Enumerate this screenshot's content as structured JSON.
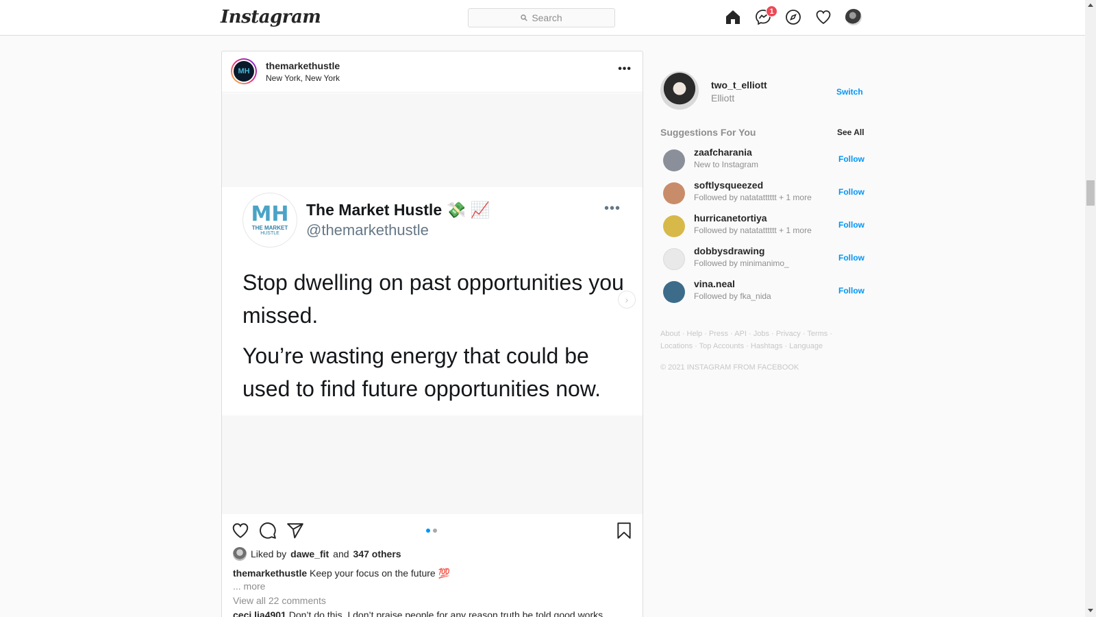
{
  "nav": {
    "logo": "Instagram",
    "search_placeholder": "Search",
    "messages_badge": "1",
    "icons": [
      "home-icon",
      "messenger-icon",
      "explore-icon",
      "activity-heart-icon",
      "profile-avatar"
    ]
  },
  "post": {
    "username": "themarkethustle",
    "location": "New York, New York",
    "more": "•••",
    "tweet": {
      "name": "The Market Hustle 💸 📈",
      "handle": "@themarkethustle",
      "logo_text": "MH",
      "logo_sub": "THE MARKET",
      "logo_sub2": "HUSTLE",
      "more": "•••",
      "text1": "Stop dwelling on past opportunities you missed.",
      "text2": "You’re wasting energy that could be used to find future opportunities now."
    },
    "next_arrow": "›",
    "carousel": {
      "count": 2,
      "active_index": 0
    },
    "likes": {
      "prefix": "Liked by",
      "user": "dawe_fit",
      "middle": "and",
      "others": "347 others"
    },
    "caption": {
      "username": "themarkethustle",
      "text": "Keep your focus on the future 💯"
    },
    "more_label": "... more",
    "view_comments": "View all 22 comments",
    "comment": {
      "username": "ceci.lia4901",
      "text": "Don’t do this. I don’t praise people for any reason truth be told good works"
    }
  },
  "sidebar": {
    "username": "two_t_elliott",
    "name": "Elliott",
    "switch": "Switch",
    "suggestions_title": "Suggestions For You",
    "see_all": "See All",
    "suggestions": [
      {
        "username": "zaafcharania",
        "sub": "New to Instagram",
        "follow": "Follow",
        "color": "#8a8f99"
      },
      {
        "username": "softlysqueezed",
        "sub": "Followed by natatatttttt + 1 more",
        "follow": "Follow",
        "color": "#c98c6a"
      },
      {
        "username": "hurricanetortiya",
        "sub": "Followed by natatatttttt + 1 more",
        "follow": "Follow",
        "color": "#d7b94a"
      },
      {
        "username": "dobbysdrawing",
        "sub": "Followed by minimanimo_",
        "follow": "Follow",
        "color": "#e9e9e9"
      },
      {
        "username": "vina.neal",
        "sub": "Followed by fka_nida",
        "follow": "Follow",
        "color": "#3c6c8a"
      }
    ],
    "footer_links": "About · Help · Press · API · Jobs · Privacy · Terms · Locations · Top Accounts · Hashtags · Language",
    "copyright": "© 2021 INSTAGRAM FROM FACEBOOK"
  },
  "colors": {
    "accent": "#0095f6",
    "badge": "#ed4956",
    "border": "#dbdbdb"
  }
}
